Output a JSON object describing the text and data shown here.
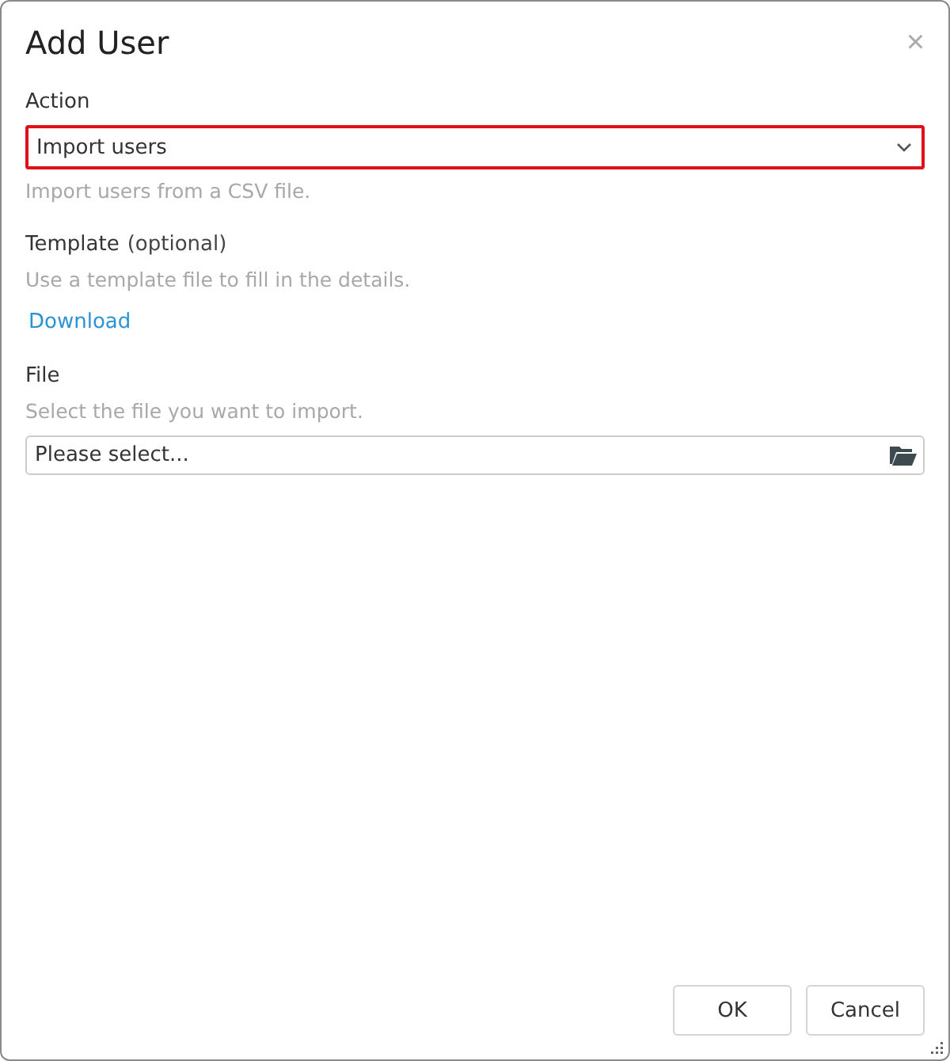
{
  "dialog": {
    "title": "Add User",
    "close": "×"
  },
  "action": {
    "label": "Action",
    "value": "Import users",
    "highlighted": true,
    "hint": "Import users from a CSV file."
  },
  "template": {
    "label": "Template",
    "note": "(optional)",
    "hint": "Use a template file to fill in the details.",
    "link": "Download"
  },
  "file": {
    "label": "File",
    "hint": "Select the file you want to import.",
    "placeholder": "Please select..."
  },
  "buttons": [
    "OK",
    "Cancel"
  ]
}
